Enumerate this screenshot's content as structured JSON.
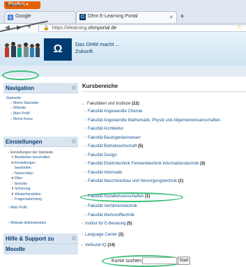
{
  "browser": {
    "app_button": "Firefox",
    "tabs": [
      {
        "label": "Google"
      },
      {
        "label": "Ohm E-Learning Portal"
      }
    ],
    "url_prefix": "https://elearning.",
    "url_domain": "ohmportal.de",
    "tab_close": "×",
    "new_tab": "+"
  },
  "banner": {
    "logo_text": "Ω",
    "tagline_line1": "Das OHM macht ...",
    "tagline_line2": "Zukunft."
  },
  "breadcrumb": {
    "label": "Startseite"
  },
  "navigation": {
    "title": "Navigation",
    "items": [
      {
        "label": "Startseite"
      },
      {
        "label": "Meine Startseite"
      },
      {
        "label": "Website"
      },
      {
        "label": "Mein Profil"
      },
      {
        "label": "Meine Kurse"
      }
    ]
  },
  "settings": {
    "title": "Einstellungen",
    "items": [
      {
        "label": "Einstellungen der Startseite"
      },
      {
        "label": "Bearbeiten einschalten"
      },
      {
        "label": "Einstellungen"
      },
      {
        "label": "bearbeiten"
      },
      {
        "label": "Nutzerrollen"
      },
      {
        "label": "Filter"
      },
      {
        "label": "Berichte"
      },
      {
        "label": "Sicherung"
      },
      {
        "label": "Wiederherstellen"
      },
      {
        "label": "Fragensammlung"
      },
      {
        "label": "Mein Profil"
      },
      {
        "label": "Website-Administration"
      }
    ]
  },
  "help": {
    "title": "Hilfe & Support zu",
    "title2": "Moodle"
  },
  "main": {
    "title": "Kursbereiche",
    "categories": [
      {
        "label": "Fakultäten und Institute",
        "count": "(12)"
      },
      {
        "label": "Fakultät Angewandte Chemie",
        "count": ""
      },
      {
        "label": "Fakultät Angewandte Mathematik, Physik und Allgemeinwissenschaften",
        "count": ""
      },
      {
        "label": "Fakultät Architektur",
        "count": ""
      },
      {
        "label": "Fakultät Bauingenieurwesen",
        "count": ""
      },
      {
        "label": "Fakultät Betriebswirtschaft",
        "count": "(5)"
      },
      {
        "label": "Fakultät Design",
        "count": ""
      },
      {
        "label": "Fakultät Elektrotechnik Feinwerktechnik Informationstechnik",
        "count": "(3)"
      },
      {
        "label": "Fakultät Informatik",
        "count": ""
      },
      {
        "label": "Fakultät Maschinenbau und Versorgungstechnik",
        "count": "(1)"
      },
      {
        "label": "Fakultät Sozialwissenschaften",
        "count": "(1)"
      },
      {
        "label": "Fakultät Verfahrenstechnik",
        "count": ""
      },
      {
        "label": "Fakultät Werkstofftechnik",
        "count": ""
      },
      {
        "label": "Institut für E-Beratung",
        "count": "(5)"
      },
      {
        "label": "Language Center",
        "count": "(2)"
      },
      {
        "label": "Verbund-IQ",
        "count": "(14)"
      }
    ],
    "search_label": "Kurse suchen:",
    "search_value": "",
    "search_button": "Start"
  },
  "colors": {
    "accent": "#003c71",
    "highlight": "#3bbf7a",
    "firefox": "#e66000"
  }
}
